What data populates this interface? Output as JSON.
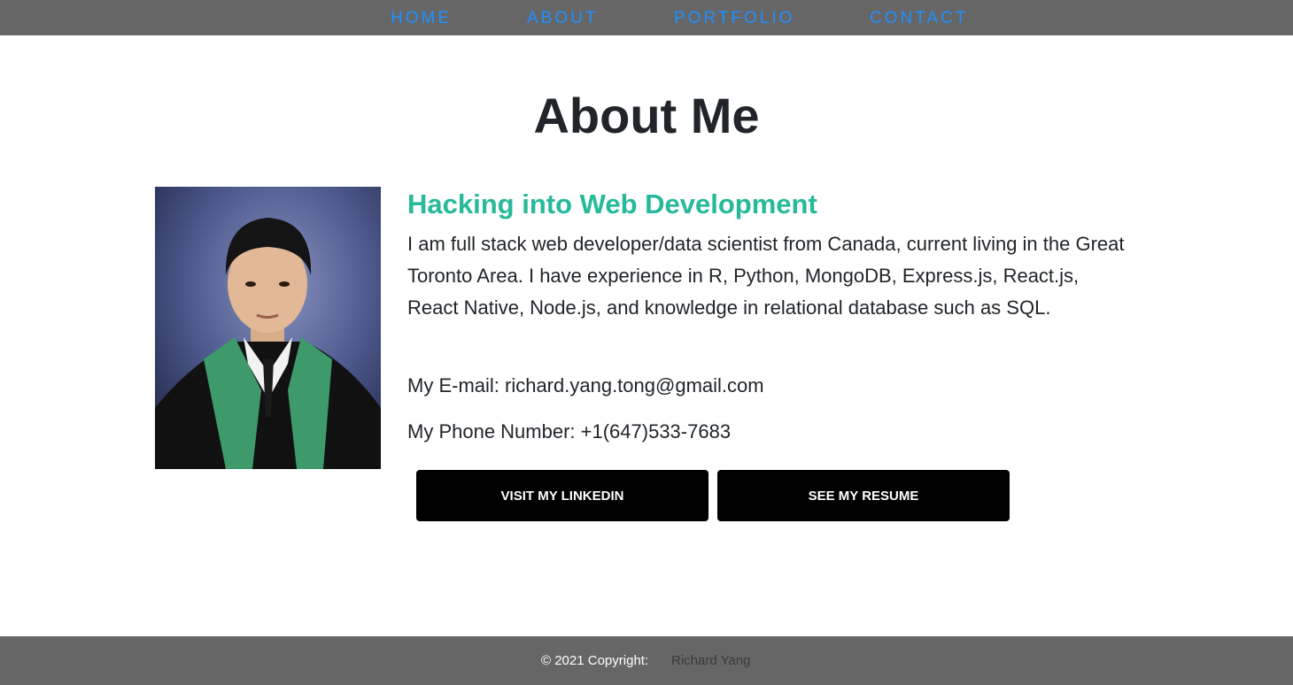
{
  "nav": {
    "items": [
      {
        "label": "HOME"
      },
      {
        "label": "ABOUT"
      },
      {
        "label": "PORTFOLIO"
      },
      {
        "label": "CONTACT"
      }
    ]
  },
  "main": {
    "title": "About Me",
    "subtitle": "Hacking into Web Development",
    "bio": "I am full stack web developer/data scientist from Canada, current living in the Great Toronto Area. I have experience in R, Python, MongoDB, Express.js, React.js, React Native, Node.js, and knowledge in relational database such as SQL.",
    "email": "My E-mail: richard.yang.tong@gmail.com",
    "phone": "My Phone Number: +1(647)533-7683",
    "buttons": {
      "linkedin": "VISIT MY LINKEDIN",
      "resume": "SEE MY RESUME"
    }
  },
  "footer": {
    "copyright": "© 2021 Copyright:",
    "author": "Richard Yang"
  },
  "colors": {
    "nav_bg": "#666666",
    "nav_link": "#1e90ff",
    "subtitle": "#26b99a",
    "button_bg": "#000000"
  }
}
